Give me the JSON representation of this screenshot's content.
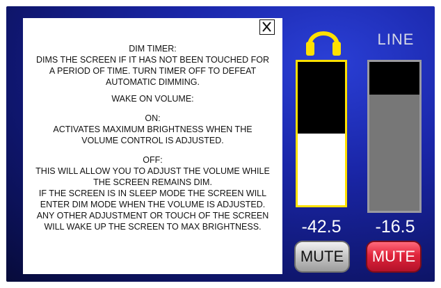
{
  "help": {
    "lines": [
      "DIM TIMER:",
      "DIMS THE SCREEN IF IT HAS NOT BEEN TOUCHED FOR",
      "A PERIOD OF TIME. TURN TIMER OFF TO DEFEAT",
      "AUTOMATIC DIMMING.",
      "WAKE ON VOLUME:",
      "ON:",
      "ACTIVATES MAXIMUM BRIGHTNESS WHEN THE",
      "VOLUME CONTROL IS ADJUSTED.",
      "OFF:",
      "THIS WILL ALLOW YOU TO  ADJUST THE VOLUME WHILE",
      "THE SCREEN REMAINS DIM.",
      "IF THE SCREEN IS IN SLEEP MODE THE SCREEN WILL",
      "ENTER DIM MODE WHEN THE VOLUME IS ADJUSTED.",
      "ANY OTHER ADJUSTMENT OR TOUCH OF THE SCREEN",
      "WILL WAKE UP THE SCREEN TO MAX BRIGHTNESS."
    ],
    "close_icon": "close-x-icon"
  },
  "headphone": {
    "icon": "headphones-icon",
    "level_text": "-42.5",
    "fill_fraction": 0.5,
    "mute_label": "MUTE",
    "accent_color": "#ffe000"
  },
  "line": {
    "label": "LINE",
    "level_text": "-16.5",
    "fill_fraction": 0.78,
    "mute_label": "MUTE",
    "mute_color": "#e0243b"
  }
}
